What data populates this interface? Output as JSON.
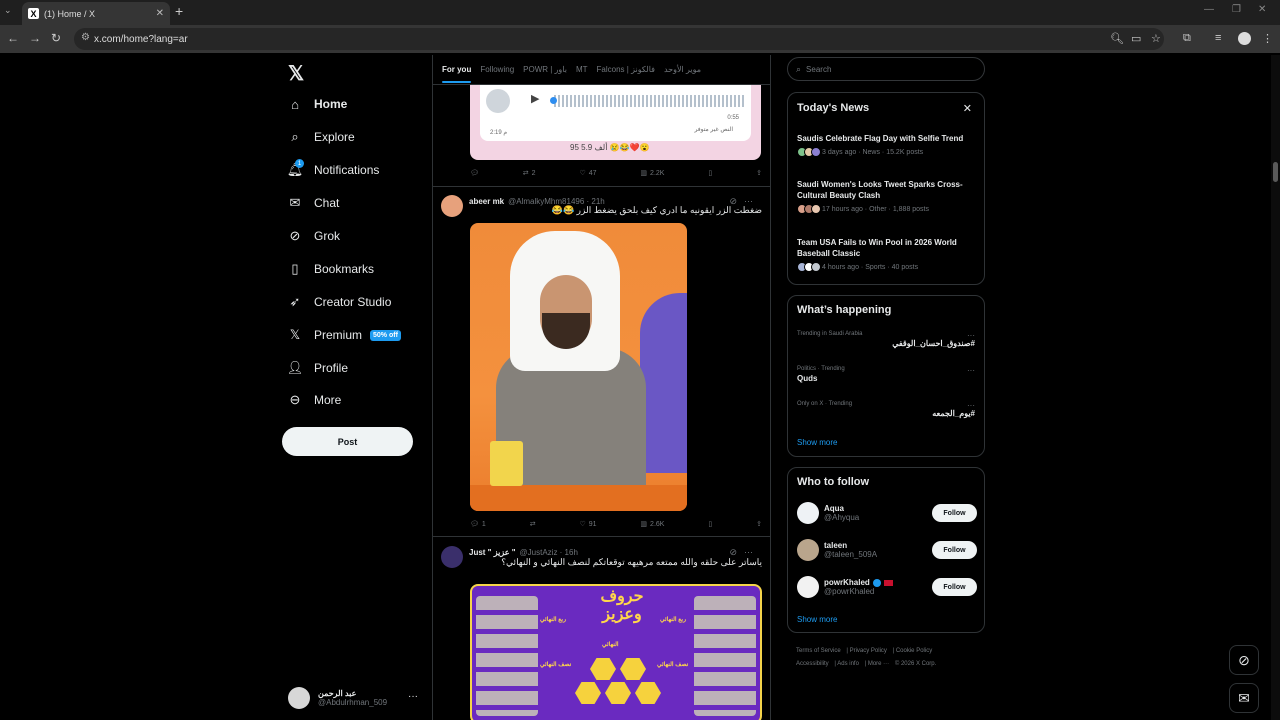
{
  "browser": {
    "tab_title": "(1) Home / X",
    "url": "x.com/home?lang=ar"
  },
  "nav": {
    "items": [
      {
        "label": "Home",
        "icon": "home-icon"
      },
      {
        "label": "Explore",
        "icon": "search-icon"
      },
      {
        "label": "Notifications",
        "icon": "bell-icon",
        "badge": "1"
      },
      {
        "label": "Chat",
        "icon": "mail-icon"
      },
      {
        "label": "Grok",
        "icon": "grok-icon"
      },
      {
        "label": "Bookmarks",
        "icon": "bookmark-icon"
      },
      {
        "label": "Creator Studio",
        "icon": "rocket-icon"
      },
      {
        "label": "Premium",
        "icon": "x-icon",
        "promo": "50% off"
      },
      {
        "label": "Profile",
        "icon": "person-icon"
      },
      {
        "label": "More",
        "icon": "more-circle-icon"
      }
    ],
    "post_label": "Post",
    "account": {
      "name": "عبد الرحمن",
      "handle": "@Abdulrhman_509"
    }
  },
  "feed": {
    "tabs": [
      "For you",
      "Following",
      "POWR | باور",
      "MT",
      "Falcons | فالكونز",
      "موير الأوحد"
    ],
    "voice_post": {
      "duration": "0:55",
      "time": "2:19 م",
      "status": "النص غير متوفر",
      "reactions": "95  5.9 ألف 😢😂❤️😮",
      "actions": {
        "replies": "",
        "reposts": "2",
        "likes": "47",
        "views": "2.2K"
      }
    },
    "post1": {
      "name": "abeer mk",
      "handle": "@AlmalkyMhm81496",
      "time": "21h",
      "text": "ضغطت الزر ايقونيه ما ادري كيف بلحق يضغط الزر 😂😂",
      "actions": {
        "replies": "1",
        "reposts": "",
        "likes": "91",
        "views": "2.6K"
      }
    },
    "post2": {
      "name": "Just \" عزيز \"",
      "handle": "@JustAziz",
      "time": "16h",
      "text": "ياساتر على حلقه والله ممتعه مرهيهه توقعاتكم لنصف النهائي و النهائي؟",
      "image_title": "حروف وعزيز",
      "image_labels": [
        "ربع النهائي",
        "نصف النهائي",
        "النهائي",
        "ربع النهائي",
        "نصف النهائي"
      ]
    }
  },
  "search": {
    "placeholder": "Search"
  },
  "news": {
    "title": "Today's News",
    "items": [
      {
        "title": "Saudis Celebrate Flag Day with Selfie Trend",
        "meta": "3 days ago · News · 15.2K posts"
      },
      {
        "title": "Saudi Women's Looks Tweet Sparks Cross-Cultural Beauty Clash",
        "meta": "17 hours ago · Other · 1,888 posts"
      },
      {
        "title": "Team USA Fails to Win Pool in 2026 World Baseball Classic",
        "meta": "4 hours ago · Sports · 40 posts"
      }
    ]
  },
  "happening": {
    "title": "What’s happening",
    "items": [
      {
        "context": "Trending in Saudi Arabia",
        "topic": "#صندوق_احسان_الوقفي"
      },
      {
        "context": "Politics · Trending",
        "topic": "Quds"
      },
      {
        "context": "Only on X · Trending",
        "topic": "#يوم_الجمعه"
      }
    ],
    "show_more": "Show more"
  },
  "who_to_follow": {
    "title": "Who to follow",
    "users": [
      {
        "name": "Aqua",
        "handle": "@Ahyqua"
      },
      {
        "name": "taleen",
        "handle": "@taleen_509A"
      },
      {
        "name": "powrKhaled",
        "handle": "@powrKhaled"
      }
    ],
    "follow_label": "Follow",
    "show_more": "Show more"
  },
  "footer": [
    "Terms of Service",
    "Privacy Policy",
    "Cookie Policy",
    "Accessibility",
    "Ads info",
    "More ···",
    "© 2026 X Corp."
  ]
}
